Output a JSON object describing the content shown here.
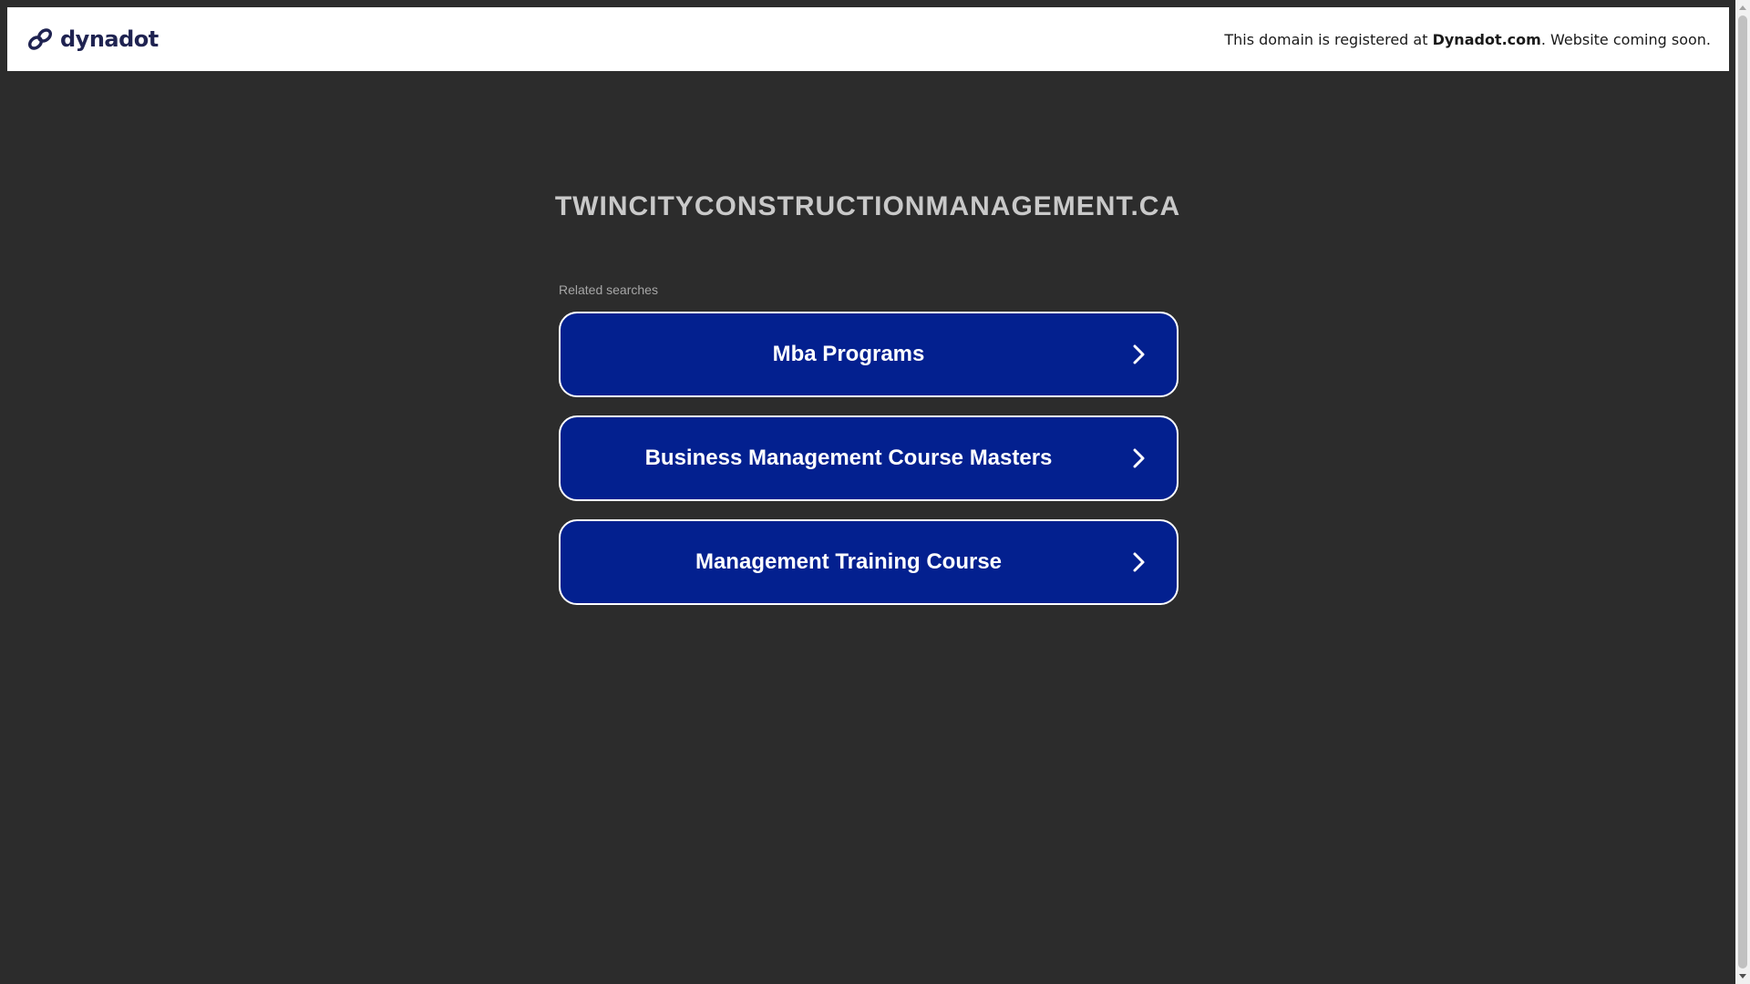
{
  "header": {
    "logo_text": "dynadot",
    "notice_prefix": "This domain is registered at ",
    "notice_brand": "Dynadot.com",
    "notice_suffix": ". Website coming soon."
  },
  "main": {
    "domain": "TWINCITYCONSTRUCTIONMANAGEMENT.CA",
    "related_label": "Related searches",
    "searches": [
      {
        "label": "Mba Programs"
      },
      {
        "label": "Business Management Course Masters"
      },
      {
        "label": "Management Training Course"
      }
    ]
  },
  "colors": {
    "page_background": "#2c2c2c",
    "header_background": "#ffffff",
    "button_background": "#03208f",
    "button_border": "#ffffff",
    "logo": "#1f2351"
  },
  "icons": {
    "logo": "dynadot-link-icon",
    "button_arrow": "chevron-right-icon"
  }
}
